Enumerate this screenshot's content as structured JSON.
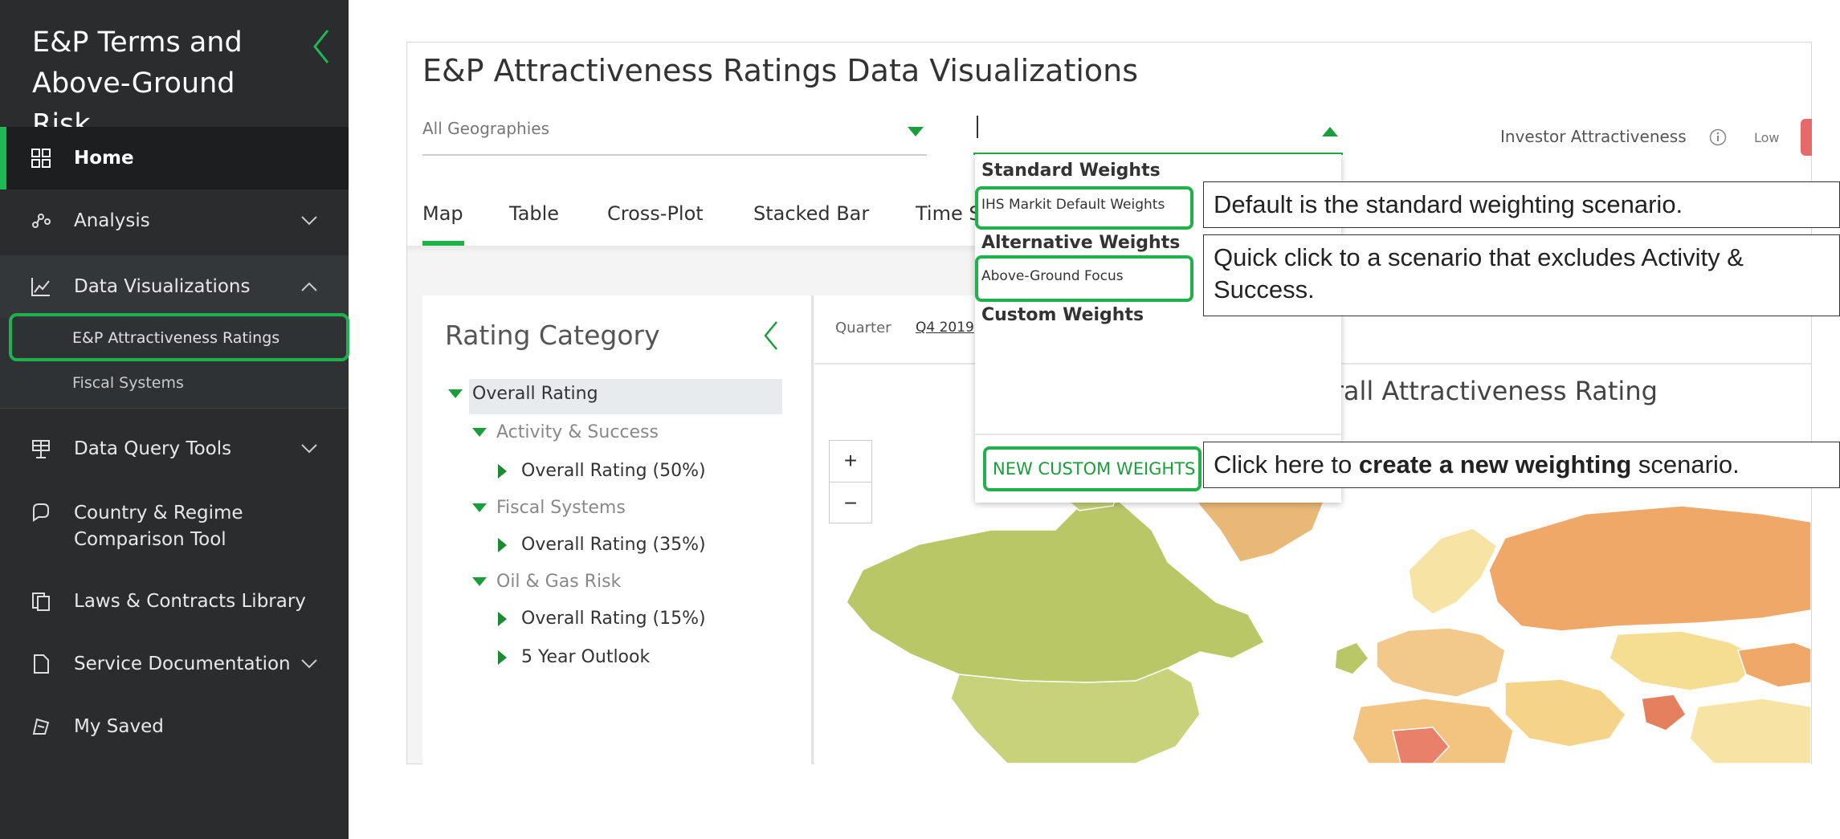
{
  "sidebar": {
    "app_title": "E&P Terms and Above-Ground Risk",
    "items": [
      {
        "label": "Home",
        "icon": "grid-icon"
      },
      {
        "label": "Analysis",
        "icon": "analysis-icon"
      },
      {
        "label": "Data Visualizations",
        "icon": "line-chart-icon"
      },
      {
        "label": "Data Query Tools",
        "icon": "query-icon"
      },
      {
        "label": "Country & Regime Comparison Tool",
        "icon": "compare-icon"
      },
      {
        "label": "Laws & Contracts Library",
        "icon": "library-icon"
      },
      {
        "label": "Service Documentation",
        "icon": "document-icon"
      },
      {
        "label": "My Saved",
        "icon": "saved-icon"
      }
    ],
    "sub_items": [
      "E&P Attractiveness Ratings",
      "Fiscal Systems"
    ],
    "accent": "#20b24a"
  },
  "main": {
    "title": "E&P Attractiveness Ratings Data Visualizations",
    "geography_select": "All Geographies",
    "investor_label": "Investor Attractiveness",
    "legend_low": "Low",
    "tabs": [
      "Map",
      "Table",
      "Cross-Plot",
      "Stacked Bar",
      "Time S"
    ],
    "active_tab": "Map"
  },
  "rating_panel": {
    "title": "Rating Category",
    "tree": [
      "Overall Rating",
      "Activity & Success",
      "Overall Rating (50%)",
      "Fiscal Systems",
      "Overall Rating (35%)",
      "Oil & Gas Risk",
      "Overall Rating (15%)",
      "5 Year Outlook"
    ]
  },
  "map": {
    "quarter_label": "Quarter",
    "quarter_value": "Q4 2019",
    "title": "erall Attractiveness Rating",
    "zoom_in": "+",
    "zoom_out": "−"
  },
  "dropdown": {
    "standard_header": "Standard Weights",
    "standard_item": "IHS Markit Default Weights",
    "alternative_header": "Alternative Weights",
    "alternative_item": "Above-Ground Focus",
    "custom_header": "Custom Weights",
    "new_button": "NEW CUSTOM WEIGHTS"
  },
  "callouts": {
    "default": "Default is the standard weighting scenario.",
    "quick": "Quick click to a scenario that excludes Activity & Success.",
    "create_pre": "Click here to ",
    "create_bold": "create a new weighting",
    "create_post": " scenario."
  }
}
